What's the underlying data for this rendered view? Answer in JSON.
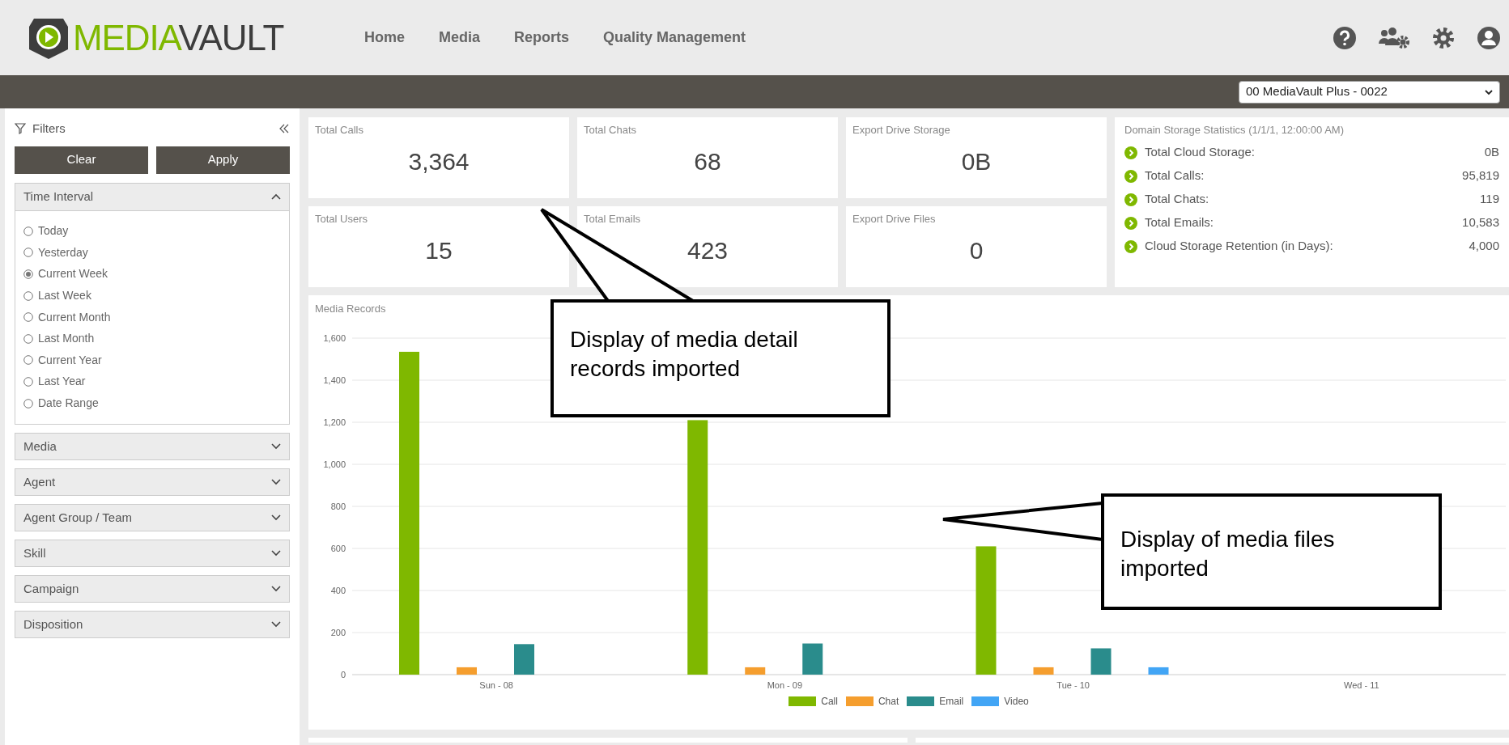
{
  "header": {
    "logo": {
      "text_1": "MEDIA",
      "text_2": "VAULT"
    },
    "nav": [
      "Home",
      "Media",
      "Reports",
      "Quality Management"
    ]
  },
  "toolbar": {
    "account_select": "00 MediaVault Plus - 0022"
  },
  "sidebar": {
    "title": "Filters",
    "buttons": [
      "Clear",
      "Apply"
    ],
    "sections": [
      {
        "label": "Time Interval",
        "expanded": true,
        "options": [
          {
            "label": "Today",
            "selected": false
          },
          {
            "label": "Yesterday",
            "selected": false
          },
          {
            "label": "Current Week",
            "selected": true
          },
          {
            "label": "Last Week",
            "selected": false
          },
          {
            "label": "Current Month",
            "selected": false
          },
          {
            "label": "Last Month",
            "selected": false
          },
          {
            "label": "Current Year",
            "selected": false
          },
          {
            "label": "Last Year",
            "selected": false
          },
          {
            "label": "Date Range",
            "selected": false
          }
        ]
      },
      {
        "label": "Media",
        "expanded": false
      },
      {
        "label": "Agent",
        "expanded": false
      },
      {
        "label": "Agent Group / Team",
        "expanded": false
      },
      {
        "label": "Skill",
        "expanded": false
      },
      {
        "label": "Campaign",
        "expanded": false
      },
      {
        "label": "Disposition",
        "expanded": false
      }
    ]
  },
  "cards": [
    {
      "label": "Total Calls",
      "value": "3,364"
    },
    {
      "label": "Total Chats",
      "value": "68"
    },
    {
      "label": "Export Drive Storage",
      "value": "0B"
    },
    {
      "label": "Total Users",
      "value": "15"
    },
    {
      "label": "Total Emails",
      "value": "423"
    },
    {
      "label": "Export Drive Files",
      "value": "0"
    }
  ],
  "storage": {
    "title": "Domain Storage Statistics (1/1/1, 12:00:00 AM)",
    "items": [
      {
        "label": "Total Cloud Storage:",
        "value": "0B"
      },
      {
        "label": "Total Calls:",
        "value": "95,819"
      },
      {
        "label": "Total Chats:",
        "value": "119"
      },
      {
        "label": "Total Emails:",
        "value": "10,583"
      },
      {
        "label": "Cloud Storage Retention (in Days):",
        "value": "4,000"
      }
    ]
  },
  "media_records": {
    "title": "Media Records",
    "chart_data": {
      "type": "bar",
      "grid": true,
      "legend": true,
      "categories": [
        "Sun - 08",
        "Mon - 09",
        "Tue - 10",
        "Wed - 11"
      ],
      "ylim": [
        0,
        1600
      ],
      "yticks": [
        {
          "value": 0,
          "label": "0"
        },
        {
          "value": 200,
          "label": "200"
        },
        {
          "value": 400,
          "label": "400"
        },
        {
          "value": 600,
          "label": "600"
        },
        {
          "value": 800,
          "label": "800"
        },
        {
          "value": 1000,
          "label": "1,000"
        },
        {
          "value": 1200,
          "label": "1,200"
        },
        {
          "value": 1400,
          "label": "1,400"
        },
        {
          "value": 1600,
          "label": "1,600"
        }
      ],
      "series": [
        {
          "name": "Call",
          "color": "#7fb800",
          "values": [
            1535,
            1210,
            610,
            null
          ]
        },
        {
          "name": "Chat",
          "color": "#f59e2e",
          "values": [
            35,
            35,
            35,
            null
          ]
        },
        {
          "name": "Email",
          "color": "#2a8c8c",
          "values": [
            145,
            148,
            125,
            null
          ]
        },
        {
          "name": "Video",
          "color": "#42a5f5",
          "values": [
            null,
            null,
            35,
            null
          ]
        }
      ]
    }
  },
  "callouts": [
    {
      "text": "Display of media detail records imported"
    },
    {
      "text": "Display of media files imported"
    }
  ]
}
